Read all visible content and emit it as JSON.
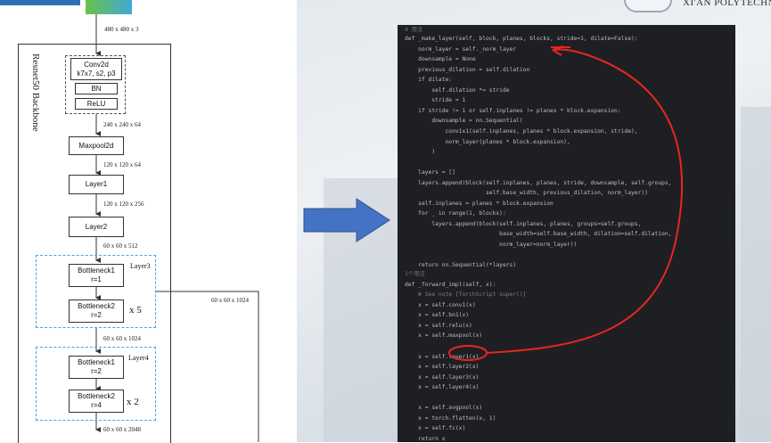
{
  "header": {
    "university_name": "XI'AN POLYTECHNIC"
  },
  "diagram": {
    "backbone_label": "Resnet50 Backbone",
    "input_dim": "480 x 480 x 3",
    "stem": {
      "conv_title": "Conv2d",
      "conv_detail": "k7x7, s2, p3",
      "bn": "BN",
      "relu": "ReLU"
    },
    "dims": {
      "after_stem": "240 x 240 x 64",
      "after_maxpool": "120 x 120 x 64",
      "after_layer1": "120 x 120 x 256",
      "after_layer2": "60 x 60 x 512",
      "after_layer3": "60 x 60 x 1024",
      "side_output": "60 x 60 x 1024",
      "after_layer4": "60 x 60 x 2048"
    },
    "maxpool": "Maxpool2d",
    "layer1": "Layer1",
    "layer2": "Layer2",
    "layer3": {
      "tag": "Layer3",
      "b1_title": "Bottleneck1",
      "b1_rate": "r=1",
      "b2_title": "Bottleneck2",
      "b2_rate": "r=2",
      "repeat": "x 5"
    },
    "layer4": {
      "tag": "Layer4",
      "b1_title": "Bottleneck1",
      "b1_rate": "r=2",
      "b2_title": "Bottleneck2",
      "b2_rate": "r=4",
      "repeat": "x 2"
    }
  },
  "code": {
    "usage_hint_1": "4 用法",
    "usage_hint_2": "1个用法",
    "lines": [
      "def _make_layer(self, block, planes, blocks, stride=1, dilate=False):",
      "    norm_layer = self._norm_layer",
      "    downsample = None",
      "    previous_dilation = self.dilation",
      "    if dilate:",
      "        self.dilation *= stride",
      "        stride = 1",
      "    if stride != 1 or self.inplanes != planes * block.expansion:",
      "        downsample = nn.Sequential(",
      "            conv1x1(self.inplanes, planes * block.expansion, stride),",
      "            norm_layer(planes * block.expansion),",
      "        )",
      "",
      "    layers = []",
      "    layers.append(block(self.inplanes, planes, stride, downsample, self.groups,",
      "                        self.base_width, previous_dilation, norm_layer))",
      "    self.inplanes = planes * block.expansion",
      "    for _ in range(1, blocks):",
      "        layers.append(block(self.inplanes, planes, groups=self.groups,",
      "                            base_width=self.base_width, dilation=self.dilation,",
      "                            norm_layer=norm_layer))",
      "",
      "    return nn.Sequential(*layers)",
      "def _forward_impl(self, x):",
      "    # See note [TorchScript super()]",
      "    x = self.conv1(x)",
      "    x = self.bn1(x)",
      "    x = self.relu(x)",
      "    x = self.maxpool(x)",
      "",
      "    x = self.layer1(x)",
      "    x = self.layer2(x)",
      "    x = self.layer3(x)",
      "    x = self.layer4(x)",
      "",
      "    x = self.avgpool(x)",
      "    x = torch.flatten(x, 1)",
      "    x = self.fc(x)",
      "    return x"
    ]
  },
  "colors": {
    "arrow_blue": "#4472c4",
    "annotation_red": "#e8261f",
    "dashed_blue": "#4aa3df",
    "code_bg": "#1e1f22"
  }
}
